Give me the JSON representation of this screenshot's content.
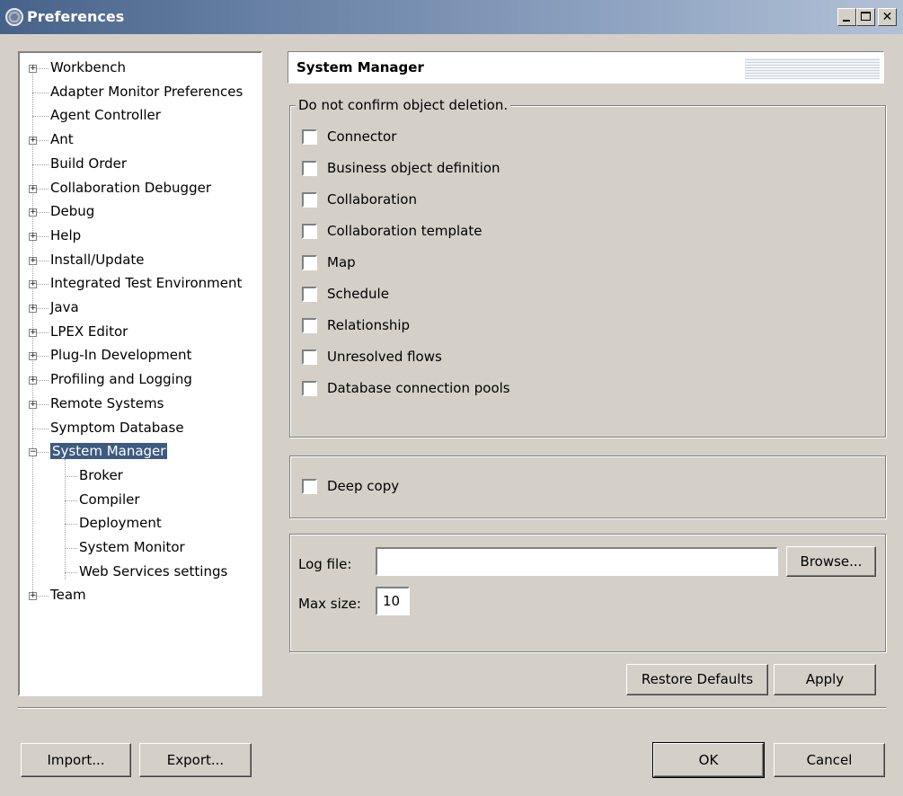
{
  "window": {
    "title": "Preferences"
  },
  "tree": {
    "items": [
      {
        "label": "Workbench",
        "expander": "+"
      },
      {
        "label": "Adapter Monitor Preferences",
        "expander": ""
      },
      {
        "label": "Agent Controller",
        "expander": ""
      },
      {
        "label": "Ant",
        "expander": "+"
      },
      {
        "label": "Build Order",
        "expander": ""
      },
      {
        "label": "Collaboration Debugger",
        "expander": "+"
      },
      {
        "label": "Debug",
        "expander": "+"
      },
      {
        "label": "Help",
        "expander": "+"
      },
      {
        "label": "Install/Update",
        "expander": "+"
      },
      {
        "label": "Integrated Test Environment",
        "expander": "+"
      },
      {
        "label": "Java",
        "expander": "+"
      },
      {
        "label": "LPEX Editor",
        "expander": "+"
      },
      {
        "label": "Plug-In Development",
        "expander": "+"
      },
      {
        "label": "Profiling and Logging",
        "expander": "+"
      },
      {
        "label": "Remote Systems",
        "expander": "+"
      },
      {
        "label": "Symptom Database",
        "expander": ""
      },
      {
        "label": "System Manager",
        "expander": "−",
        "selected": true
      },
      {
        "label": "Broker",
        "expander": "",
        "child": true
      },
      {
        "label": "Compiler",
        "expander": "",
        "child": true
      },
      {
        "label": "Deployment",
        "expander": "",
        "child": true
      },
      {
        "label": "System Monitor",
        "expander": "",
        "child": true
      },
      {
        "label": "Web Services settings",
        "expander": "",
        "child": true
      },
      {
        "label": "Team",
        "expander": "+"
      }
    ]
  },
  "page": {
    "title": "System Manager",
    "deletion_group": {
      "legend": "Do not confirm object deletion.",
      "options": [
        {
          "label": "Connector",
          "checked": false
        },
        {
          "label": "Business object definition",
          "checked": false
        },
        {
          "label": "Collaboration",
          "checked": false
        },
        {
          "label": "Collaboration template",
          "checked": false
        },
        {
          "label": "Map",
          "checked": false
        },
        {
          "label": "Schedule",
          "checked": false
        },
        {
          "label": "Relationship",
          "checked": false
        },
        {
          "label": "Unresolved flows",
          "checked": false
        },
        {
          "label": "Database connection pools",
          "checked": false
        }
      ]
    },
    "deep_copy": {
      "label": "Deep copy",
      "checked": false
    },
    "log": {
      "log_file_label": "Log file:",
      "log_file_value": "",
      "browse_label": "Browse...",
      "max_size_label": "Max size:",
      "max_size_value": "10"
    },
    "restore_defaults_label": "Restore Defaults",
    "apply_label": "Apply"
  },
  "footer": {
    "import_label": "Import...",
    "export_label": "Export...",
    "ok_label": "OK",
    "cancel_label": "Cancel"
  }
}
